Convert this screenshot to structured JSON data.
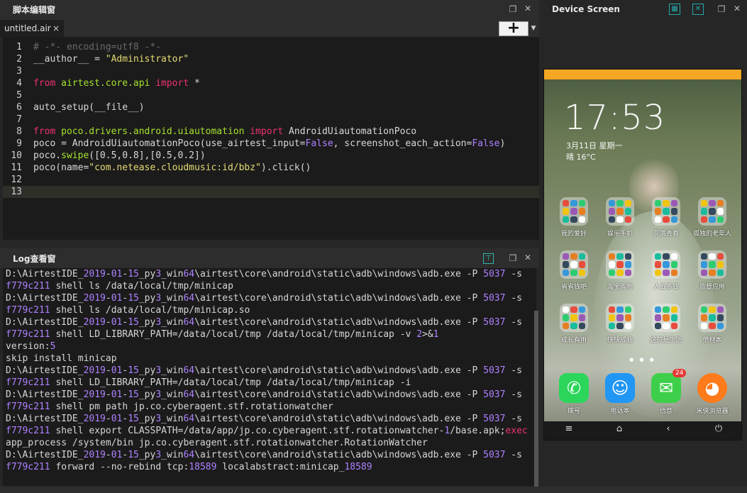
{
  "editor": {
    "title": "脚本编辑窗",
    "tab_label": "untitled.air",
    "tab_close": "×",
    "add_label": "+",
    "lines": [
      {
        "n": "1",
        "parts": [
          {
            "t": "# -*- encoding=utf8 -*-",
            "c": "cm"
          }
        ]
      },
      {
        "n": "2",
        "parts": [
          {
            "t": "__author__ = ",
            "c": ""
          },
          {
            "t": "\"Administrator\"",
            "c": "st"
          }
        ]
      },
      {
        "n": "3",
        "parts": []
      },
      {
        "n": "4",
        "parts": [
          {
            "t": "from",
            "c": "kw"
          },
          {
            "t": " airtest.core.api ",
            "c": "mod"
          },
          {
            "t": "import",
            "c": "kw"
          },
          {
            "t": " *",
            "c": ""
          }
        ]
      },
      {
        "n": "5",
        "parts": []
      },
      {
        "n": "6",
        "parts": [
          {
            "t": "auto_setup(__file__)",
            "c": ""
          }
        ]
      },
      {
        "n": "7",
        "parts": []
      },
      {
        "n": "8",
        "parts": [
          {
            "t": "from",
            "c": "kw"
          },
          {
            "t": " poco.drivers.android.uiautomation ",
            "c": "mod"
          },
          {
            "t": "import",
            "c": "kw"
          },
          {
            "t": " AndroidUiautomationPoco",
            "c": ""
          }
        ]
      },
      {
        "n": "9",
        "parts": [
          {
            "t": "poco = AndroidUiautomationPoco(use_airtest_input=",
            "c": ""
          },
          {
            "t": "False",
            "c": "bo"
          },
          {
            "t": ", screenshot_each_action=",
            "c": ""
          },
          {
            "t": "False",
            "c": "bo"
          },
          {
            "t": ")",
            "c": ""
          }
        ]
      },
      {
        "n": "10",
        "parts": [
          {
            "t": "poco.",
            "c": ""
          },
          {
            "t": "swipe",
            "c": "fn"
          },
          {
            "t": "([0.5,0.8],[0.5,0.2])",
            "c": ""
          }
        ]
      },
      {
        "n": "11",
        "parts": [
          {
            "t": "poco(name=",
            "c": ""
          },
          {
            "t": "\"com.netease.cloudmusic:id/bbz\"",
            "c": "st"
          },
          {
            "t": ").click()",
            "c": ""
          }
        ]
      },
      {
        "n": "12",
        "parts": []
      },
      {
        "n": "13",
        "parts": []
      }
    ]
  },
  "log": {
    "title": "Log查看窗",
    "lines": [
      [
        {
          "t": "D:\\AirtestIDE_",
          "c": ""
        },
        {
          "t": "2019",
          "c": "num"
        },
        {
          "t": "-",
          "c": ""
        },
        {
          "t": "01",
          "c": "num"
        },
        {
          "t": "-",
          "c": ""
        },
        {
          "t": "15",
          "c": "num"
        },
        {
          "t": "_py",
          "c": ""
        },
        {
          "t": "3",
          "c": "num"
        },
        {
          "t": "_win",
          "c": ""
        },
        {
          "t": "64",
          "c": "num"
        },
        {
          "t": "\\airtest\\core\\android\\static\\adb\\windows\\adb.exe -P ",
          "c": ""
        },
        {
          "t": "5037",
          "c": "num"
        },
        {
          "t": " -s",
          "c": ""
        }
      ],
      [
        {
          "t": "f779c211",
          "c": "num"
        },
        {
          "t": " shell ls /data/local/tmp/minicap",
          "c": ""
        }
      ],
      [
        {
          "t": "D:\\AirtestIDE_",
          "c": ""
        },
        {
          "t": "2019",
          "c": "num"
        },
        {
          "t": "-",
          "c": ""
        },
        {
          "t": "01",
          "c": "num"
        },
        {
          "t": "-",
          "c": ""
        },
        {
          "t": "15",
          "c": "num"
        },
        {
          "t": "_py",
          "c": ""
        },
        {
          "t": "3",
          "c": "num"
        },
        {
          "t": "_win",
          "c": ""
        },
        {
          "t": "64",
          "c": "num"
        },
        {
          "t": "\\airtest\\core\\android\\static\\adb\\windows\\adb.exe -P ",
          "c": ""
        },
        {
          "t": "5037",
          "c": "num"
        },
        {
          "t": " -s",
          "c": ""
        }
      ],
      [
        {
          "t": "f779c211",
          "c": "num"
        },
        {
          "t": " shell ls /data/local/tmp/minicap.so",
          "c": ""
        }
      ],
      [
        {
          "t": "D:\\AirtestIDE_",
          "c": ""
        },
        {
          "t": "2019",
          "c": "num"
        },
        {
          "t": "-",
          "c": ""
        },
        {
          "t": "01",
          "c": "num"
        },
        {
          "t": "-",
          "c": ""
        },
        {
          "t": "15",
          "c": "num"
        },
        {
          "t": "_py",
          "c": ""
        },
        {
          "t": "3",
          "c": "num"
        },
        {
          "t": "_win",
          "c": ""
        },
        {
          "t": "64",
          "c": "num"
        },
        {
          "t": "\\airtest\\core\\android\\static\\adb\\windows\\adb.exe -P ",
          "c": ""
        },
        {
          "t": "5037",
          "c": "num"
        },
        {
          "t": " -s",
          "c": ""
        }
      ],
      [
        {
          "t": "f779c211",
          "c": "num"
        },
        {
          "t": " shell LD_LIBRARY_PATH=/data/local/tmp /data/local/tmp/minicap -v ",
          "c": ""
        },
        {
          "t": "2",
          "c": "num"
        },
        {
          "t": ">&",
          "c": ""
        },
        {
          "t": "1",
          "c": "num"
        }
      ],
      [
        {
          "t": "version:",
          "c": ""
        },
        {
          "t": "5",
          "c": "num"
        }
      ],
      [
        {
          "t": "skip install minicap",
          "c": ""
        }
      ],
      [
        {
          "t": "D:\\AirtestIDE_",
          "c": ""
        },
        {
          "t": "2019",
          "c": "num"
        },
        {
          "t": "-",
          "c": ""
        },
        {
          "t": "01",
          "c": "num"
        },
        {
          "t": "-",
          "c": ""
        },
        {
          "t": "15",
          "c": "num"
        },
        {
          "t": "_py",
          "c": ""
        },
        {
          "t": "3",
          "c": "num"
        },
        {
          "t": "_win",
          "c": ""
        },
        {
          "t": "64",
          "c": "num"
        },
        {
          "t": "\\airtest\\core\\android\\static\\adb\\windows\\adb.exe -P ",
          "c": ""
        },
        {
          "t": "5037",
          "c": "num"
        },
        {
          "t": " -s",
          "c": ""
        }
      ],
      [
        {
          "t": "f779c211",
          "c": "num"
        },
        {
          "t": " shell LD_LIBRARY_PATH=/data/local/tmp /data/local/tmp/minicap -i",
          "c": ""
        }
      ],
      [
        {
          "t": "D:\\AirtestIDE_",
          "c": ""
        },
        {
          "t": "2019",
          "c": "num"
        },
        {
          "t": "-",
          "c": ""
        },
        {
          "t": "01",
          "c": "num"
        },
        {
          "t": "-",
          "c": ""
        },
        {
          "t": "15",
          "c": "num"
        },
        {
          "t": "_py",
          "c": ""
        },
        {
          "t": "3",
          "c": "num"
        },
        {
          "t": "_win",
          "c": ""
        },
        {
          "t": "64",
          "c": "num"
        },
        {
          "t": "\\airtest\\core\\android\\static\\adb\\windows\\adb.exe -P ",
          "c": ""
        },
        {
          "t": "5037",
          "c": "num"
        },
        {
          "t": " -s",
          "c": ""
        }
      ],
      [
        {
          "t": "f779c211",
          "c": "num"
        },
        {
          "t": " shell pm path jp.co.cyberagent.stf.rotationwatcher",
          "c": ""
        }
      ],
      [
        {
          "t": "D:\\AirtestIDE_",
          "c": ""
        },
        {
          "t": "2019",
          "c": "num"
        },
        {
          "t": "-",
          "c": ""
        },
        {
          "t": "01",
          "c": "num"
        },
        {
          "t": "-",
          "c": ""
        },
        {
          "t": "15",
          "c": "num"
        },
        {
          "t": "_py",
          "c": ""
        },
        {
          "t": "3",
          "c": "num"
        },
        {
          "t": "_win",
          "c": ""
        },
        {
          "t": "64",
          "c": "num"
        },
        {
          "t": "\\airtest\\core\\android\\static\\adb\\windows\\adb.exe -P ",
          "c": ""
        },
        {
          "t": "5037",
          "c": "num"
        },
        {
          "t": " -s",
          "c": ""
        }
      ],
      [
        {
          "t": "f779c211",
          "c": "num"
        },
        {
          "t": " shell export CLASSPATH=/data/app/jp.co.cyberagent.stf.rotationwatcher-",
          "c": ""
        },
        {
          "t": "1",
          "c": "num"
        },
        {
          "t": "/base.apk;",
          "c": ""
        },
        {
          "t": "exec",
          "c": "ex"
        }
      ],
      [
        {
          "t": "app_process /system/bin jp.co.cyberagent.stf.rotationwatcher.RotationWatcher",
          "c": ""
        }
      ],
      [
        {
          "t": "D:\\AirtestIDE_",
          "c": ""
        },
        {
          "t": "2019",
          "c": "num"
        },
        {
          "t": "-",
          "c": ""
        },
        {
          "t": "01",
          "c": "num"
        },
        {
          "t": "-",
          "c": ""
        },
        {
          "t": "15",
          "c": "num"
        },
        {
          "t": "_py",
          "c": ""
        },
        {
          "t": "3",
          "c": "num"
        },
        {
          "t": "_win",
          "c": ""
        },
        {
          "t": "64",
          "c": "num"
        },
        {
          "t": "\\airtest\\core\\android\\static\\adb\\windows\\adb.exe -P ",
          "c": ""
        },
        {
          "t": "5037",
          "c": "num"
        },
        {
          "t": " -s",
          "c": ""
        }
      ],
      [
        {
          "t": "f779c211",
          "c": "num"
        },
        {
          "t": " forward --no-rebind tcp:",
          "c": ""
        },
        {
          "t": "18589",
          "c": "num"
        },
        {
          "t": " localabstract:minicap_",
          "c": ""
        },
        {
          "t": "18589",
          "c": "num"
        }
      ]
    ]
  },
  "device": {
    "title": "Device Screen",
    "clock": "17:53",
    "date": "3月11日 星期一",
    "weather": "晴 16°C",
    "folders": [
      "我的爱好",
      "娱乐手机",
      "花落青春",
      "孤独的老年人",
      "省省钱吧",
      "淘宝购物",
      "人五多钱",
      "监督应用",
      "成长有用",
      "快快成我",
      "这就是生活",
      "借材本"
    ],
    "dock": [
      "拨号",
      "电话本",
      "信息",
      "米侠浏览器"
    ],
    "badge": "24",
    "nav": [
      "≡",
      "⌂",
      "‹",
      "⏻"
    ]
  },
  "colors": {
    "status_bar": "#f5a623",
    "accent": "#f0326e"
  }
}
